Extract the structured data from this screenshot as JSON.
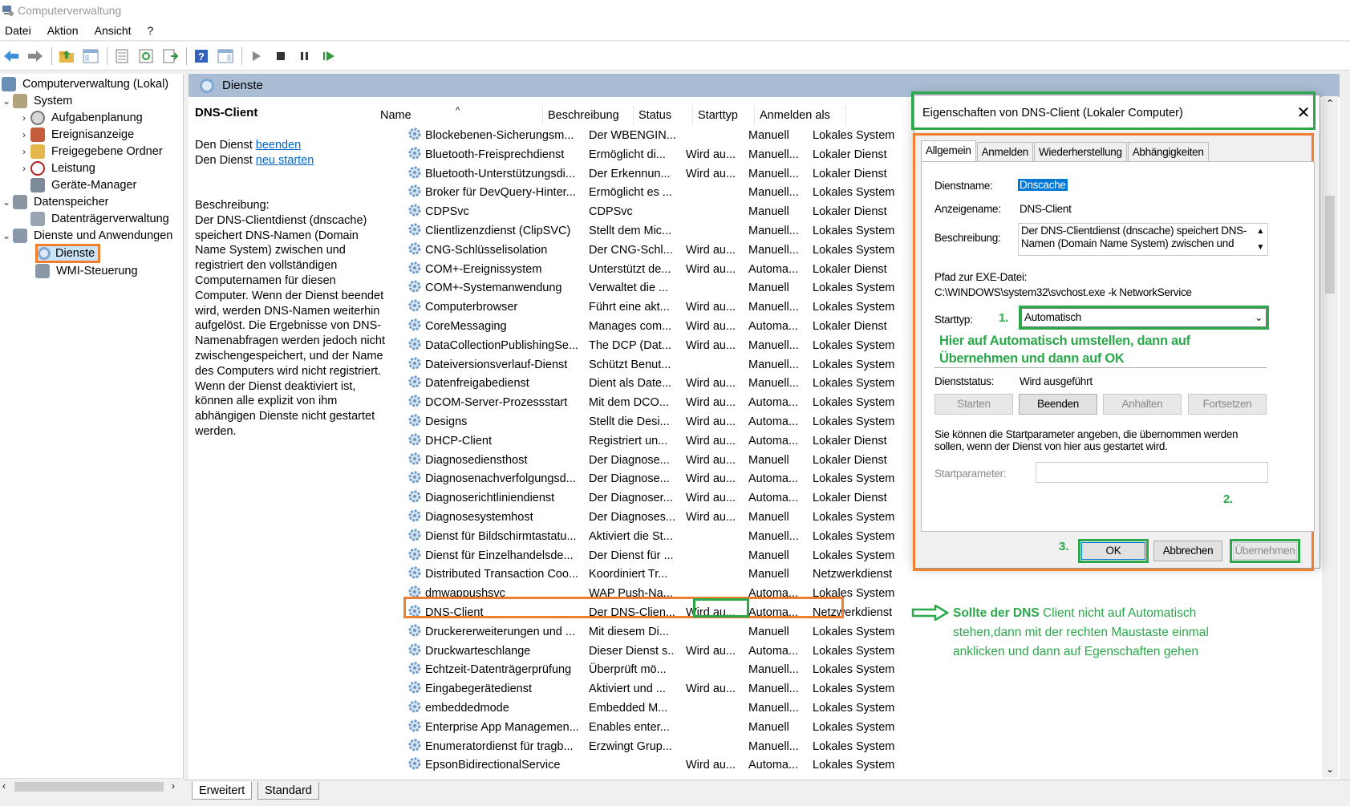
{
  "window": {
    "title": "Computerverwaltung"
  },
  "menu": [
    "Datei",
    "Aktion",
    "Ansicht",
    "?"
  ],
  "tree": {
    "root": "Computerverwaltung (Lokal)",
    "system": "System",
    "aufgabenplanung": "Aufgabenplanung",
    "ereignisanzeige": "Ereignisanzeige",
    "freigegebene_ordner": "Freigegebene Ordner",
    "leistung": "Leistung",
    "geraete_manager": "Geräte-Manager",
    "datenspeicher": "Datenspeicher",
    "datentraeger": "Datenträgerverwaltung",
    "dienste_anwendungen": "Dienste und Anwendungen",
    "dienste": "Dienste",
    "wmi": "WMI-Steuerung"
  },
  "pane": {
    "header": "Dienste",
    "selected_title": "DNS-Client",
    "link_prefix_1": "Den Dienst ",
    "link_1": "beenden",
    "link_prefix_2": "Den Dienst ",
    "link_2": "neu starten",
    "description": "Beschreibung:\nDer DNS-Clientdienst (dnscache) speichert DNS-Namen (Domain Name System) zwischen und registriert den vollständigen Computernamen für diesen Computer. Wenn der Dienst beendet wird, werden DNS-Namen weiterhin aufgelöst. Die Ergebnisse von DNS-Namenabfragen werden jedoch nicht zwischengespeichert, und der Name des Computers wird nicht registriert. Wenn der Dienst deaktiviert ist, können alle explizit von ihm abhängigen Dienste nicht gestartet werden."
  },
  "columns": {
    "name": "Name",
    "desc": "Beschreibung",
    "status": "Status",
    "start": "Starttyp",
    "logon": "Anmelden als"
  },
  "rows": [
    [
      "Blockebenen-Sicherungsm...",
      "Der WBENGIN...",
      "",
      "Manuell",
      "Lokales System"
    ],
    [
      "Bluetooth-Freisprechdienst",
      "Ermöglicht di...",
      "Wird au...",
      "Manuell...",
      "Lokaler Dienst"
    ],
    [
      "Bluetooth-Unterstützungsdi...",
      "Der Erkennun...",
      "Wird au...",
      "Manuell...",
      "Lokaler Dienst"
    ],
    [
      "Broker für DevQuery-Hinter...",
      "Ermöglicht es ...",
      "",
      "Manuell...",
      "Lokales System"
    ],
    [
      "CDPSvc",
      "CDPSvc",
      "",
      "Manuell",
      "Lokaler Dienst"
    ],
    [
      "Clientlizenzdienst (ClipSVC)",
      "Stellt dem Mic...",
      "",
      "Manuell...",
      "Lokales System"
    ],
    [
      "CNG-Schlüsselisolation",
      "Der CNG-Schl...",
      "Wird au...",
      "Manuell...",
      "Lokales System"
    ],
    [
      "COM+-Ereignissystem",
      "Unterstützt de...",
      "Wird au...",
      "Automa...",
      "Lokaler Dienst"
    ],
    [
      "COM+-Systemanwendung",
      "Verwaltet die ...",
      "",
      "Manuell",
      "Lokales System"
    ],
    [
      "Computerbrowser",
      "Führt eine akt...",
      "Wird au...",
      "Manuell...",
      "Lokales System"
    ],
    [
      "CoreMessaging",
      "Manages com...",
      "Wird au...",
      "Automa...",
      "Lokaler Dienst"
    ],
    [
      "DataCollectionPublishingSe...",
      "The DCP (Dat...",
      "Wird au...",
      "Manuell...",
      "Lokales System"
    ],
    [
      "Dateiversionsverlauf-Dienst",
      "Schützt Benut...",
      "",
      "Manuell...",
      "Lokales System"
    ],
    [
      "Datenfreigabedienst",
      "Dient als Date...",
      "Wird au...",
      "Manuell...",
      "Lokales System"
    ],
    [
      "DCOM-Server-Prozessstart",
      "Mit dem DCO...",
      "Wird au...",
      "Automa...",
      "Lokales System"
    ],
    [
      "Designs",
      "Stellt die Desi...",
      "Wird au...",
      "Automa...",
      "Lokales System"
    ],
    [
      "DHCP-Client",
      "Registriert un...",
      "Wird au...",
      "Automa...",
      "Lokaler Dienst"
    ],
    [
      "Diagnosediensthost",
      "Der Diagnose...",
      "Wird au...",
      "Manuell",
      "Lokaler Dienst"
    ],
    [
      "Diagnosenachverfolgungsd...",
      "Der Diagnose...",
      "Wird au...",
      "Automa...",
      "Lokales System"
    ],
    [
      "Diagnoserichtliniendienst",
      "Der Diagnoser...",
      "Wird au...",
      "Automa...",
      "Lokaler Dienst"
    ],
    [
      "Diagnosesystemhost",
      "Der Diagnoses...",
      "Wird au...",
      "Manuell",
      "Lokales System"
    ],
    [
      "Dienst für Bildschirmtastatu...",
      "Aktiviert die St...",
      "",
      "Manuell...",
      "Lokales System"
    ],
    [
      "Dienst für Einzelhandelsde...",
      "Der Dienst für ...",
      "",
      "Manuell",
      "Lokales System"
    ],
    [
      "Distributed Transaction Coo...",
      "Koordiniert Tr...",
      "",
      "Manuell",
      "Netzwerkdienst"
    ],
    [
      "dmwappushsvc",
      "WAP Push-Na...",
      "",
      "Automa...",
      "Lokales System"
    ],
    [
      "DNS-Client",
      "Der DNS-Clien...",
      "Wird au...",
      "Automa...",
      "Netzwerkdienst"
    ],
    [
      "Druckererweiterungen und ...",
      "Mit diesem Di...",
      "",
      "Manuell",
      "Lokales System"
    ],
    [
      "Druckwarteschlange",
      "Dieser Dienst s...",
      "Wird au...",
      "Automa...",
      "Lokales System"
    ],
    [
      "Echtzeit-Datenträgerprüfung",
      "Überprüft mö...",
      "",
      "Manuell...",
      "Lokales System"
    ],
    [
      "Eingabegerätedienst",
      "Aktiviert und ...",
      "Wird au...",
      "Manuell...",
      "Lokales System"
    ],
    [
      "embeddedmode",
      "Embedded M...",
      "",
      "Manuell...",
      "Lokales System"
    ],
    [
      "Enterprise App Managemen...",
      "Enables enter...",
      "",
      "Manuell",
      "Lokales System"
    ],
    [
      "Enumeratordienst für tragb...",
      "Erzwingt Grup...",
      "",
      "Manuell...",
      "Lokales System"
    ],
    [
      "EpsonBidirectionalService",
      "",
      "Wird au...",
      "Automa...",
      "Lokales System"
    ]
  ],
  "bottom_tabs": [
    "Erweitert",
    "Standard"
  ],
  "dialog": {
    "title": "Eigenschaften von DNS-Client (Lokaler Computer)",
    "tabs": [
      "Allgemein",
      "Anmelden",
      "Wiederherstellung",
      "Abhängigkeiten"
    ],
    "dienstname_label": "Dienstname:",
    "dienstname_value": "Dnscache",
    "anzeigename_label": "Anzeigename:",
    "anzeigename_value": "DNS-Client",
    "beschreibung_label": "Beschreibung:",
    "beschreibung_value": "Der DNS-Clientdienst (dnscache) speichert DNS-Namen (Domain Name System) zwischen und",
    "pfad_label": "Pfad zur EXE-Datei:",
    "pfad_value": "C:\\WINDOWS\\system32\\svchost.exe -k NetworkService",
    "starttyp_label": "Starttyp:",
    "starttyp_value": "Automatisch",
    "dienststatus_label": "Dienststatus:",
    "dienststatus_value": "Wird ausgeführt",
    "btn_starten": "Starten",
    "btn_beenden": "Beenden",
    "btn_anhalten": "Anhalten",
    "btn_fortsetzen": "Fortsetzen",
    "hint": "Sie können die Startparameter angeben, die übernommen werden sollen, wenn der Dienst von hier aus gestartet wird.",
    "startparameter_label": "Startparameter:",
    "btn_ok": "OK",
    "btn_abbrechen": "Abbrechen",
    "btn_uebernehmen": "Übernehmen"
  },
  "annotations": {
    "step1": "1.",
    "step2": "2.",
    "step3": "3.",
    "instruction": "Hier auf Automatisch umstellen, dann auf Übernehmen und dann auf OK",
    "note_bold": "Sollte der DNS",
    "note_rest": " Client nicht auf Automatisch stehen,dann mit der rechten Maustaste einmal anklicken und dann auf Egenschaften gehen"
  },
  "colors": {
    "highlight_orange": "#f08030",
    "highlight_green": "#2aa84a",
    "link": "#0066cc",
    "pane_header": "#a9bdd4"
  }
}
